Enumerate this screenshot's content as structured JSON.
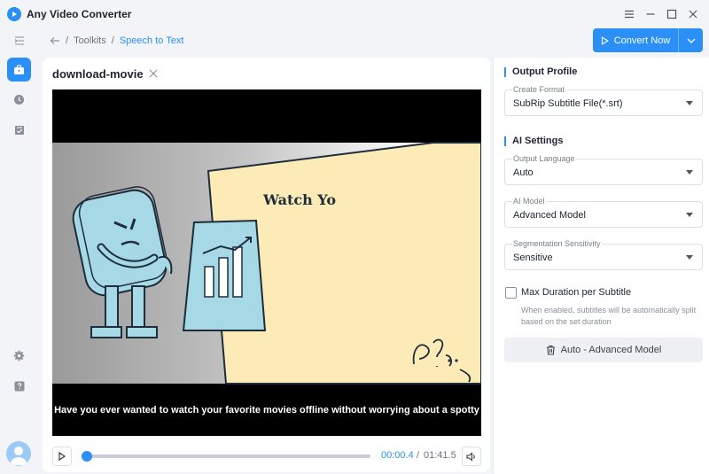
{
  "app": {
    "title": "Any Video Converter"
  },
  "breadcrumb": {
    "parent": "Toolkits",
    "separator": "/",
    "current": "Speech to Text"
  },
  "toolbar": {
    "convert_label": "Convert Now"
  },
  "sidebar": {
    "items": [
      {
        "name": "toolkit",
        "icon": "toolbox-icon",
        "active": true
      },
      {
        "name": "history",
        "icon": "clock-icon",
        "active": false
      },
      {
        "name": "tasks",
        "icon": "checklist-icon",
        "active": false
      }
    ],
    "bottom": [
      {
        "name": "settings",
        "icon": "gear-icon"
      },
      {
        "name": "help",
        "icon": "help-icon"
      }
    ]
  },
  "file": {
    "name": "download-movie"
  },
  "video": {
    "on_screen_title": "Watch Yo",
    "caption": "Have you ever wanted to watch your favorite movies offline without worrying about a spotty"
  },
  "player": {
    "current_time": "00:00.4",
    "time_separator": "/",
    "total_time": "01:41.5",
    "progress": 0.004
  },
  "output_profile": {
    "heading": "Output Profile",
    "create_format": {
      "label": "Create Format",
      "value": "SubRip Subtitle File(*.srt)"
    }
  },
  "ai_settings": {
    "heading": "AI Settings",
    "output_language": {
      "label": "Output Language",
      "value": "Auto"
    },
    "ai_model": {
      "label": "AI Model",
      "value": "Advanced Model"
    },
    "segmentation": {
      "label": "Segmentation Sensitivity",
      "value": "Sensitive"
    },
    "max_duration": {
      "label": "Max Duration per Subtitle",
      "checked": false,
      "hint": "When enabled, subtitles will be automatically split based on the set duration"
    },
    "summary_button": "Auto - Advanced Model"
  },
  "colors": {
    "accent": "#2a8ff7",
    "panel": "#ffffff",
    "background": "#f3f4f7"
  }
}
